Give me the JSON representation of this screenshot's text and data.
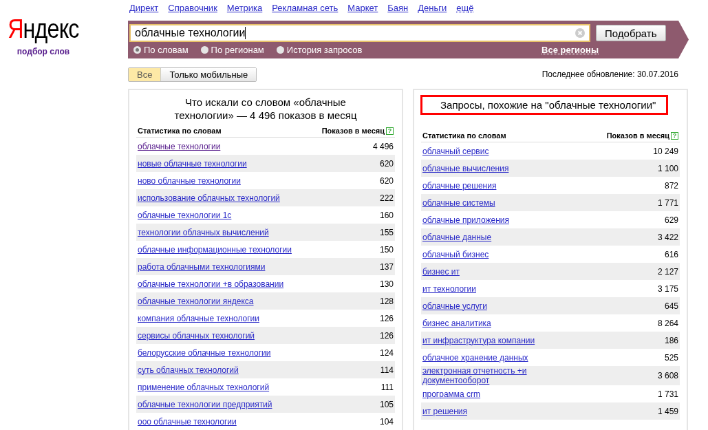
{
  "logo": {
    "first_letter": "Я",
    "rest": "ндекс",
    "subtitle": "подбор слов"
  },
  "nav": [
    {
      "label": "Директ",
      "kind": "link"
    },
    {
      "label": "Справочник",
      "kind": "link"
    },
    {
      "label": "Метрика",
      "kind": "link"
    },
    {
      "label": "Рекламная сеть",
      "kind": "link"
    },
    {
      "label": "Маркет",
      "kind": "link"
    },
    {
      "label": "Баян",
      "kind": "link"
    },
    {
      "label": "Деньги",
      "kind": "link"
    },
    {
      "label": "ещё",
      "kind": "dropdown"
    }
  ],
  "search": {
    "value": "облачные технологии",
    "button": "Подобрать",
    "region": "Все регионы",
    "modes": [
      {
        "label": "По словам",
        "selected": true
      },
      {
        "label": "По регионам",
        "selected": false
      },
      {
        "label": "История запросов",
        "selected": false
      }
    ]
  },
  "filter_tabs": [
    {
      "label": "Все",
      "selected": true
    },
    {
      "label": "Только мобильные",
      "selected": false
    }
  ],
  "last_update": "Последнее обновление: 30.07.2016",
  "panels": [
    {
      "title": "Что искали со словом «облачные технологии» — 4 496 показов в месяц",
      "highlighted": false,
      "columns": [
        "Статистика по словам",
        "Показов в месяц"
      ],
      "help": "?",
      "rows": [
        {
          "phrase": "облачные технологии",
          "count": "4 496",
          "visited": true
        },
        {
          "phrase": "новые облачные технологии",
          "count": "620",
          "visited": false
        },
        {
          "phrase": "ново облачные технологии",
          "count": "620",
          "visited": false
        },
        {
          "phrase": "использование облачных технологий",
          "count": "222",
          "visited": false
        },
        {
          "phrase": "облачные технологии 1с",
          "count": "160",
          "visited": false
        },
        {
          "phrase": "технологии облачных вычислений",
          "count": "155",
          "visited": false
        },
        {
          "phrase": "облачные информационные технологии",
          "count": "150",
          "visited": false
        },
        {
          "phrase": "работа облачными технологиями",
          "count": "137",
          "visited": false
        },
        {
          "phrase": "облачные технологии +в образовании",
          "count": "130",
          "visited": false
        },
        {
          "phrase": "облачные технологии яндекса",
          "count": "128",
          "visited": false
        },
        {
          "phrase": "компания облачные технологии",
          "count": "126",
          "visited": false
        },
        {
          "phrase": "сервисы облачных технологий",
          "count": "126",
          "visited": false
        },
        {
          "phrase": "белорусские облачные технологии",
          "count": "124",
          "visited": false
        },
        {
          "phrase": "суть облачных технологий",
          "count": "114",
          "visited": false
        },
        {
          "phrase": "применение облачных технологий",
          "count": "111",
          "visited": false
        },
        {
          "phrase": "облачные технологии предприятий",
          "count": "105",
          "visited": false
        },
        {
          "phrase": "ооо облачные технологии",
          "count": "104",
          "visited": false
        }
      ]
    },
    {
      "title": "Запросы, похожие на \"облачные технологии\"",
      "highlighted": true,
      "columns": [
        "Статистика по словам",
        "Показов в месяц"
      ],
      "help": "?",
      "rows": [
        {
          "phrase": "облачный сервис",
          "count": "10 249",
          "visited": false
        },
        {
          "phrase": "облачные вычисления",
          "count": "1 100",
          "visited": false
        },
        {
          "phrase": "облачные решения",
          "count": "872",
          "visited": false
        },
        {
          "phrase": "облачные системы",
          "count": "1 771",
          "visited": false
        },
        {
          "phrase": "облачные приложения",
          "count": "629",
          "visited": false
        },
        {
          "phrase": "облачные данные",
          "count": "3 422",
          "visited": false
        },
        {
          "phrase": "облачный бизнес",
          "count": "616",
          "visited": false
        },
        {
          "phrase": "бизнес ит",
          "count": "2 127",
          "visited": false
        },
        {
          "phrase": "ит технологии",
          "count": "3 175",
          "visited": false
        },
        {
          "phrase": "облачные услуги",
          "count": "645",
          "visited": false
        },
        {
          "phrase": "бизнес аналитика",
          "count": "8 264",
          "visited": false
        },
        {
          "phrase": "ит инфраструктура компании",
          "count": "186",
          "visited": false
        },
        {
          "phrase": "облачное хранение данных",
          "count": "525",
          "visited": false
        },
        {
          "phrase": "электронная отчетность +и документооборот",
          "count": "3 608",
          "visited": false
        },
        {
          "phrase": "программа crm",
          "count": "1 731",
          "visited": false
        },
        {
          "phrase": "ит решения",
          "count": "1 459",
          "visited": false
        }
      ]
    }
  ]
}
